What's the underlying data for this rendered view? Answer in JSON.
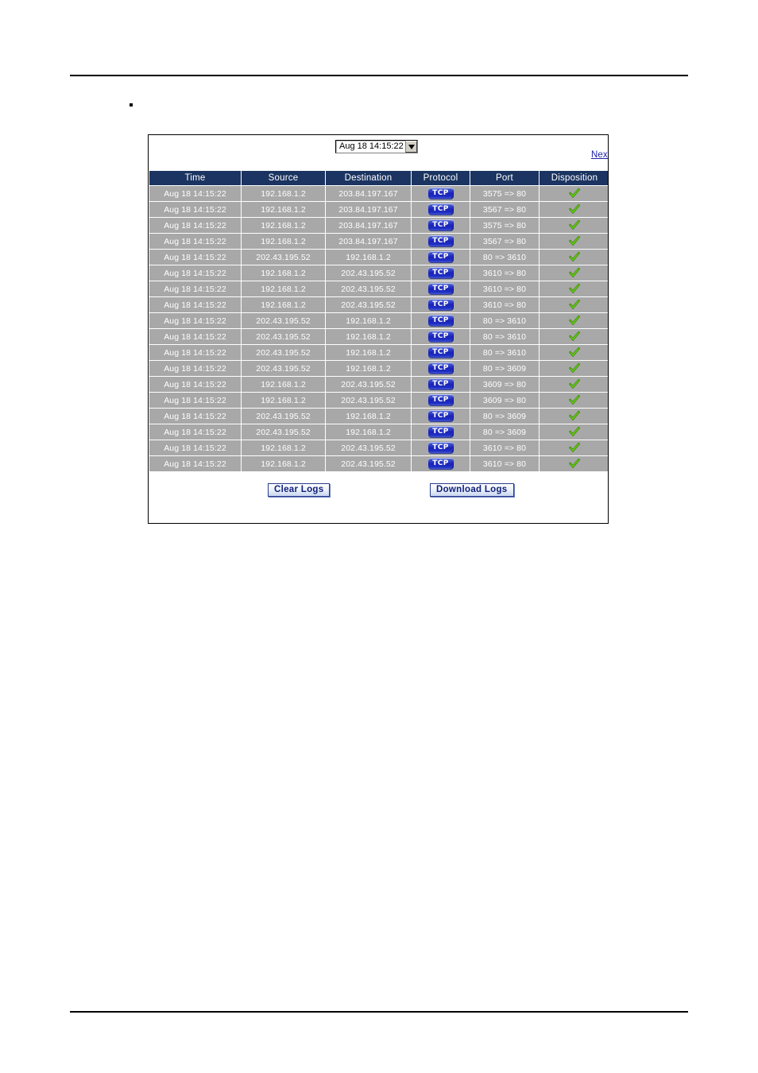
{
  "page": {
    "top_rule": true,
    "bottom_rule": true,
    "bullet": "▪"
  },
  "panel": {
    "time_filter": {
      "selected": "Aug 18 14:15:22",
      "arrow_icon": "chevron-down-icon"
    },
    "next_link": "Next",
    "columns": [
      "Time",
      "Source",
      "Destination",
      "Protocol",
      "Port",
      "Disposition"
    ],
    "protocol_label": "TCP",
    "disposition_icon": "green-check-icon",
    "rows": [
      {
        "time": "Aug 18 14:15:22",
        "source": "192.168.1.2",
        "destination": "203.84.197.167",
        "protocol": "TCP",
        "port": "3575 => 80",
        "disposition": "allowed"
      },
      {
        "time": "Aug 18 14:15:22",
        "source": "192.168.1.2",
        "destination": "203.84.197.167",
        "protocol": "TCP",
        "port": "3567 => 80",
        "disposition": "allowed"
      },
      {
        "time": "Aug 18 14:15:22",
        "source": "192.168.1.2",
        "destination": "203.84.197.167",
        "protocol": "TCP",
        "port": "3575 => 80",
        "disposition": "allowed"
      },
      {
        "time": "Aug 18 14:15:22",
        "source": "192.168.1.2",
        "destination": "203.84.197.167",
        "protocol": "TCP",
        "port": "3567 => 80",
        "disposition": "allowed"
      },
      {
        "time": "Aug 18 14:15:22",
        "source": "202.43.195.52",
        "destination": "192.168.1.2",
        "protocol": "TCP",
        "port": "80 => 3610",
        "disposition": "allowed"
      },
      {
        "time": "Aug 18 14:15:22",
        "source": "192.168.1.2",
        "destination": "202.43.195.52",
        "protocol": "TCP",
        "port": "3610 => 80",
        "disposition": "allowed"
      },
      {
        "time": "Aug 18 14:15:22",
        "source": "192.168.1.2",
        "destination": "202.43.195.52",
        "protocol": "TCP",
        "port": "3610 => 80",
        "disposition": "allowed"
      },
      {
        "time": "Aug 18 14:15:22",
        "source": "192.168.1.2",
        "destination": "202.43.195.52",
        "protocol": "TCP",
        "port": "3610 => 80",
        "disposition": "allowed"
      },
      {
        "time": "Aug 18 14:15:22",
        "source": "202.43.195.52",
        "destination": "192.168.1.2",
        "protocol": "TCP",
        "port": "80 => 3610",
        "disposition": "allowed"
      },
      {
        "time": "Aug 18 14:15:22",
        "source": "202.43.195.52",
        "destination": "192.168.1.2",
        "protocol": "TCP",
        "port": "80 => 3610",
        "disposition": "allowed"
      },
      {
        "time": "Aug 18 14:15:22",
        "source": "202.43.195.52",
        "destination": "192.168.1.2",
        "protocol": "TCP",
        "port": "80 => 3610",
        "disposition": "allowed"
      },
      {
        "time": "Aug 18 14:15:22",
        "source": "202.43.195.52",
        "destination": "192.168.1.2",
        "protocol": "TCP",
        "port": "80 => 3609",
        "disposition": "allowed"
      },
      {
        "time": "Aug 18 14:15:22",
        "source": "192.168.1.2",
        "destination": "202.43.195.52",
        "protocol": "TCP",
        "port": "3609 => 80",
        "disposition": "allowed"
      },
      {
        "time": "Aug 18 14:15:22",
        "source": "192.168.1.2",
        "destination": "202.43.195.52",
        "protocol": "TCP",
        "port": "3609 => 80",
        "disposition": "allowed"
      },
      {
        "time": "Aug 18 14:15:22",
        "source": "202.43.195.52",
        "destination": "192.168.1.2",
        "protocol": "TCP",
        "port": "80 => 3609",
        "disposition": "allowed"
      },
      {
        "time": "Aug 18 14:15:22",
        "source": "202.43.195.52",
        "destination": "192.168.1.2",
        "protocol": "TCP",
        "port": "80 => 3609",
        "disposition": "allowed"
      },
      {
        "time": "Aug 18 14:15:22",
        "source": "192.168.1.2",
        "destination": "202.43.195.52",
        "protocol": "TCP",
        "port": "3610 => 80",
        "disposition": "allowed"
      },
      {
        "time": "Aug 18 14:15:22",
        "source": "192.168.1.2",
        "destination": "202.43.195.52",
        "protocol": "TCP",
        "port": "3610 => 80",
        "disposition": "allowed"
      }
    ],
    "buttons": {
      "clear_logs": "Clear Logs",
      "download_logs": "Download Logs"
    }
  },
  "colors": {
    "header_bg": "#1b3461",
    "row_bg": "#a8a8a8",
    "row_text": "#ffffff",
    "link": "#1f1fa8",
    "tcp_badge": "#1a23b8",
    "check": "#5fd41a",
    "button_text": "#10207a"
  }
}
